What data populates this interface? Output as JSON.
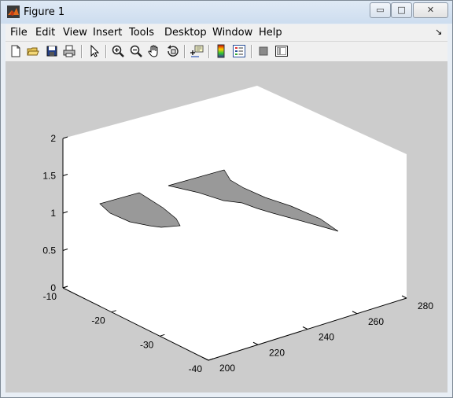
{
  "window": {
    "title": "Figure 1",
    "minimize_glyph": "▭",
    "maximize_glyph": "□",
    "close_glyph": "✕"
  },
  "menu": {
    "items": [
      "File",
      "Edit",
      "View",
      "Insert",
      "Tools",
      "Desktop",
      "Window",
      "Help"
    ],
    "dock_arrow": "↘"
  },
  "toolbar": {
    "icons": [
      "new-figure-icon",
      "open-file-icon",
      "save-icon",
      "print-icon",
      "edit-plot-arrow-icon",
      "zoom-in-icon",
      "zoom-out-icon",
      "pan-hand-icon",
      "rotate-3d-icon",
      "data-cursor-icon",
      "colorbar-icon",
      "legend-icon",
      "hide-plot-tools-icon",
      "show-plot-tools-icon"
    ]
  },
  "chart_data": {
    "type": "surface-3d",
    "z_ticks": [
      "0",
      "0.5",
      "1",
      "1.5",
      "2"
    ],
    "y_ticks": [
      "-10",
      "-20",
      "-30",
      "-40"
    ],
    "x_ticks": [
      "200",
      "220",
      "240",
      "260",
      "280"
    ],
    "xlim": [
      200,
      280
    ],
    "ylim": [
      -40,
      -10
    ],
    "zlim": [
      0,
      2
    ],
    "surface_color": "#999999",
    "axes_background": "#ffffff",
    "figure_background": "#cccccc"
  }
}
